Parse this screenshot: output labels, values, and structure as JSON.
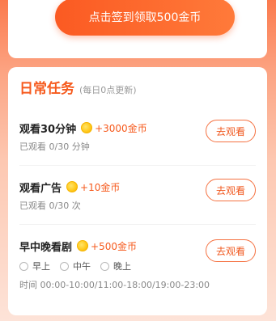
{
  "signin": {
    "button_label": "点击签到领取500金币"
  },
  "daily_tasks": {
    "title": "日常任务",
    "subtitle": "(每日0点更新)",
    "tasks": [
      {
        "name": "观看30分钟",
        "reward": "+3000金币",
        "progress": "已观看 0/30 分钟",
        "action": "去观看"
      },
      {
        "name": "观看广告",
        "reward": "+10金币",
        "progress": "已观看 0/30 次",
        "action": "去观看"
      },
      {
        "name": "早中晚看剧",
        "reward": "+500金币",
        "options": [
          "早上",
          "中午",
          "晚上"
        ],
        "time": "时间 00:00-10:00/11:00-18:00/19:00-23:00",
        "action": "去观看"
      }
    ]
  },
  "colors": {
    "accent": "#f65a1d",
    "button_gradient_start": "#fb5a22",
    "coin": "#ffc81a"
  }
}
